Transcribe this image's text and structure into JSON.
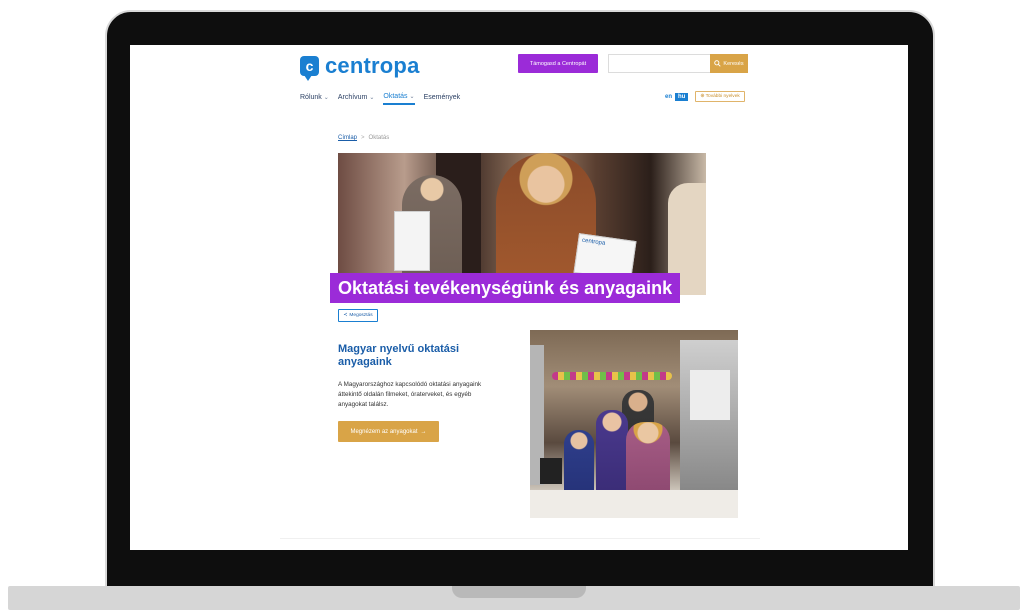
{
  "site": {
    "logo_letter": "c",
    "logo_text": "centropa"
  },
  "header": {
    "support_label": "Támogasd a Centropát",
    "search_placeholder": "",
    "search_label": "Keresés"
  },
  "nav": {
    "items": [
      {
        "label": "Rólunk",
        "has_dropdown": true
      },
      {
        "label": "Archívum",
        "has_dropdown": true
      },
      {
        "label": "Oktatás",
        "has_dropdown": true,
        "active": true
      },
      {
        "label": "Események",
        "has_dropdown": false
      }
    ]
  },
  "language": {
    "en": "en",
    "hu": "hu",
    "more": "További nyelvek"
  },
  "breadcrumb": {
    "home": "Címlap",
    "separator": ">",
    "current": "Oktatás"
  },
  "hero": {
    "title": "Oktatási tevékenységünk és anyagaink",
    "cert_text": "centropa"
  },
  "share": {
    "label": "Megosztás"
  },
  "section": {
    "title": "Magyar nyelvű oktatási anyagaink",
    "text": "A Magyarországhoz kapcsolódó oktatási anyagaink áttekintő oldalán filmeket, óraterveket, és egyéb anyagokat találsz.",
    "cta_label": "Megnézem az anyagokat",
    "cta_arrow": "→"
  },
  "icons": {
    "search": "search-icon",
    "share": "share-icon",
    "globe": "globe-icon",
    "chevron": "chevron-down-icon"
  },
  "colors": {
    "brand_blue": "#1a7fd1",
    "purple": "#9b2bd8",
    "gold": "#d9a447"
  }
}
